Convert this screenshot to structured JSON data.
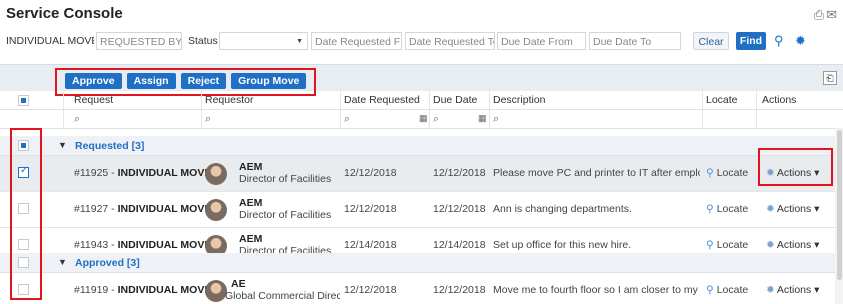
{
  "app": {
    "title": "Service Console"
  },
  "title_icons": {
    "print": "print-icon",
    "email": "email-icon"
  },
  "filters": {
    "type_value": "INDIVIDUAL MOVES",
    "requested_by_placeholder": "REQUESTED BY",
    "status_label": "Status",
    "status_value": "",
    "date_requested_from": "Date Requested Fror",
    "date_requested_to": "Date Requested To",
    "due_date_from": "Due Date From",
    "due_date_to": "Due Date To",
    "clear_label": "Clear",
    "find_label": "Find",
    "pin_icon": "map-pin-icon",
    "settings_icon": "gear-icon"
  },
  "toolbar": {
    "approve_label": "Approve",
    "assign_label": "Assign",
    "reject_label": "Reject",
    "group_move_label": "Group Move",
    "export_icon": "export-icon"
  },
  "columns": {
    "request": "Request",
    "requestor": "Requestor",
    "date_requested": "Date Requested",
    "due_date": "Due Date",
    "description": "Description",
    "locate": "Locate",
    "actions": "Actions"
  },
  "groups": [
    {
      "label": "Requested [3]",
      "expanded": true
    },
    {
      "label": "Approved [3]",
      "expanded": true
    }
  ],
  "rows": [
    {
      "id": "#11925",
      "type": "INDIVIDUAL MOVE",
      "requestor_name": "AEM",
      "requestor_title": "Director of Facilities",
      "date_requested": "12/12/2018",
      "due_date": "12/12/2018",
      "description": "Please move PC and printer to IT after emplo...",
      "locate": "Locate",
      "actions": "Actions",
      "checked": true
    },
    {
      "id": "#11927",
      "type": "INDIVIDUAL MOVE",
      "requestor_name": "AEM",
      "requestor_title": "Director of Facilities",
      "date_requested": "12/12/2018",
      "due_date": "12/12/2018",
      "description": "Ann is changing departments.",
      "locate": "Locate",
      "actions": "Actions",
      "checked": false
    },
    {
      "id": "#11943",
      "type": "INDIVIDUAL MOVE",
      "requestor_name": "AEM",
      "requestor_title": "Director of Facilities",
      "date_requested": "12/14/2018",
      "due_date": "12/14/2018",
      "description": "Set up office for this new hire.",
      "locate": "Locate",
      "actions": "Actions",
      "checked": false
    },
    {
      "id": "#11919",
      "type": "INDIVIDUAL MOVE",
      "requestor_name": "AE",
      "requestor_title": "Global Commercial Directc",
      "date_requested": "12/12/2018",
      "due_date": "12/12/2018",
      "description": "Move me to fourth floor so I am closer to my ...",
      "locate": "Locate",
      "actions": "Actions",
      "checked": false
    }
  ]
}
